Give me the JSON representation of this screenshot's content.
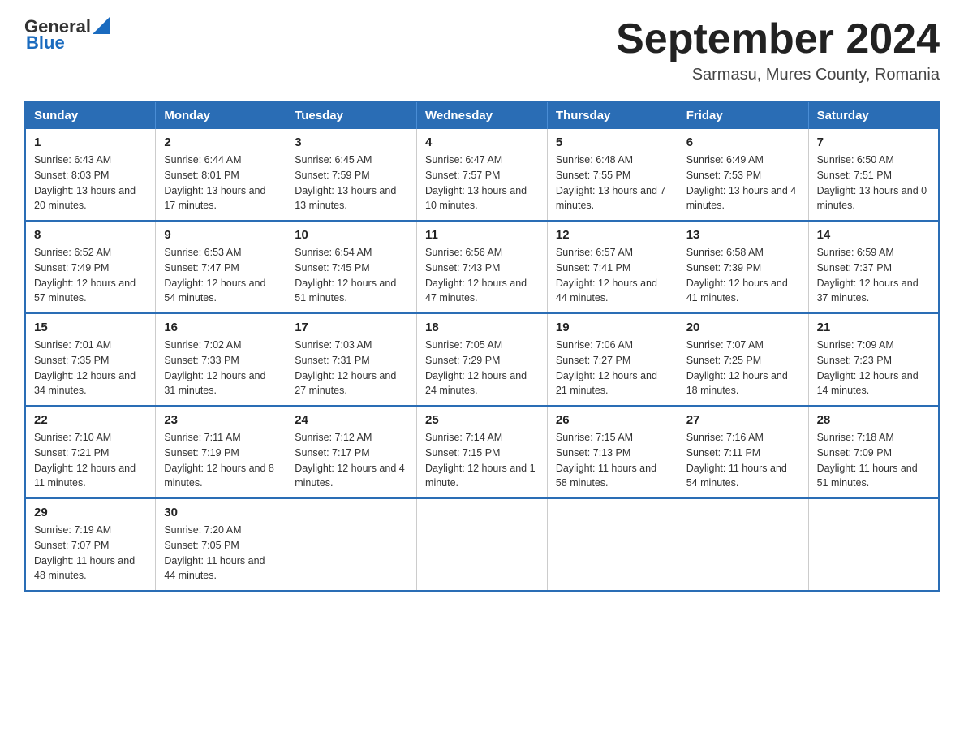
{
  "header": {
    "logo_general": "General",
    "logo_blue": "Blue",
    "title": "September 2024",
    "subtitle": "Sarmasu, Mures County, Romania"
  },
  "days_of_week": [
    "Sunday",
    "Monday",
    "Tuesday",
    "Wednesday",
    "Thursday",
    "Friday",
    "Saturday"
  ],
  "weeks": [
    [
      {
        "day": "1",
        "sunrise": "6:43 AM",
        "sunset": "8:03 PM",
        "daylight": "13 hours and 20 minutes."
      },
      {
        "day": "2",
        "sunrise": "6:44 AM",
        "sunset": "8:01 PM",
        "daylight": "13 hours and 17 minutes."
      },
      {
        "day": "3",
        "sunrise": "6:45 AM",
        "sunset": "7:59 PM",
        "daylight": "13 hours and 13 minutes."
      },
      {
        "day": "4",
        "sunrise": "6:47 AM",
        "sunset": "7:57 PM",
        "daylight": "13 hours and 10 minutes."
      },
      {
        "day": "5",
        "sunrise": "6:48 AM",
        "sunset": "7:55 PM",
        "daylight": "13 hours and 7 minutes."
      },
      {
        "day": "6",
        "sunrise": "6:49 AM",
        "sunset": "7:53 PM",
        "daylight": "13 hours and 4 minutes."
      },
      {
        "day": "7",
        "sunrise": "6:50 AM",
        "sunset": "7:51 PM",
        "daylight": "13 hours and 0 minutes."
      }
    ],
    [
      {
        "day": "8",
        "sunrise": "6:52 AM",
        "sunset": "7:49 PM",
        "daylight": "12 hours and 57 minutes."
      },
      {
        "day": "9",
        "sunrise": "6:53 AM",
        "sunset": "7:47 PM",
        "daylight": "12 hours and 54 minutes."
      },
      {
        "day": "10",
        "sunrise": "6:54 AM",
        "sunset": "7:45 PM",
        "daylight": "12 hours and 51 minutes."
      },
      {
        "day": "11",
        "sunrise": "6:56 AM",
        "sunset": "7:43 PM",
        "daylight": "12 hours and 47 minutes."
      },
      {
        "day": "12",
        "sunrise": "6:57 AM",
        "sunset": "7:41 PM",
        "daylight": "12 hours and 44 minutes."
      },
      {
        "day": "13",
        "sunrise": "6:58 AM",
        "sunset": "7:39 PM",
        "daylight": "12 hours and 41 minutes."
      },
      {
        "day": "14",
        "sunrise": "6:59 AM",
        "sunset": "7:37 PM",
        "daylight": "12 hours and 37 minutes."
      }
    ],
    [
      {
        "day": "15",
        "sunrise": "7:01 AM",
        "sunset": "7:35 PM",
        "daylight": "12 hours and 34 minutes."
      },
      {
        "day": "16",
        "sunrise": "7:02 AM",
        "sunset": "7:33 PM",
        "daylight": "12 hours and 31 minutes."
      },
      {
        "day": "17",
        "sunrise": "7:03 AM",
        "sunset": "7:31 PM",
        "daylight": "12 hours and 27 minutes."
      },
      {
        "day": "18",
        "sunrise": "7:05 AM",
        "sunset": "7:29 PM",
        "daylight": "12 hours and 24 minutes."
      },
      {
        "day": "19",
        "sunrise": "7:06 AM",
        "sunset": "7:27 PM",
        "daylight": "12 hours and 21 minutes."
      },
      {
        "day": "20",
        "sunrise": "7:07 AM",
        "sunset": "7:25 PM",
        "daylight": "12 hours and 18 minutes."
      },
      {
        "day": "21",
        "sunrise": "7:09 AM",
        "sunset": "7:23 PM",
        "daylight": "12 hours and 14 minutes."
      }
    ],
    [
      {
        "day": "22",
        "sunrise": "7:10 AM",
        "sunset": "7:21 PM",
        "daylight": "12 hours and 11 minutes."
      },
      {
        "day": "23",
        "sunrise": "7:11 AM",
        "sunset": "7:19 PM",
        "daylight": "12 hours and 8 minutes."
      },
      {
        "day": "24",
        "sunrise": "7:12 AM",
        "sunset": "7:17 PM",
        "daylight": "12 hours and 4 minutes."
      },
      {
        "day": "25",
        "sunrise": "7:14 AM",
        "sunset": "7:15 PM",
        "daylight": "12 hours and 1 minute."
      },
      {
        "day": "26",
        "sunrise": "7:15 AM",
        "sunset": "7:13 PM",
        "daylight": "11 hours and 58 minutes."
      },
      {
        "day": "27",
        "sunrise": "7:16 AM",
        "sunset": "7:11 PM",
        "daylight": "11 hours and 54 minutes."
      },
      {
        "day": "28",
        "sunrise": "7:18 AM",
        "sunset": "7:09 PM",
        "daylight": "11 hours and 51 minutes."
      }
    ],
    [
      {
        "day": "29",
        "sunrise": "7:19 AM",
        "sunset": "7:07 PM",
        "daylight": "11 hours and 48 minutes."
      },
      {
        "day": "30",
        "sunrise": "7:20 AM",
        "sunset": "7:05 PM",
        "daylight": "11 hours and 44 minutes."
      },
      null,
      null,
      null,
      null,
      null
    ]
  ]
}
